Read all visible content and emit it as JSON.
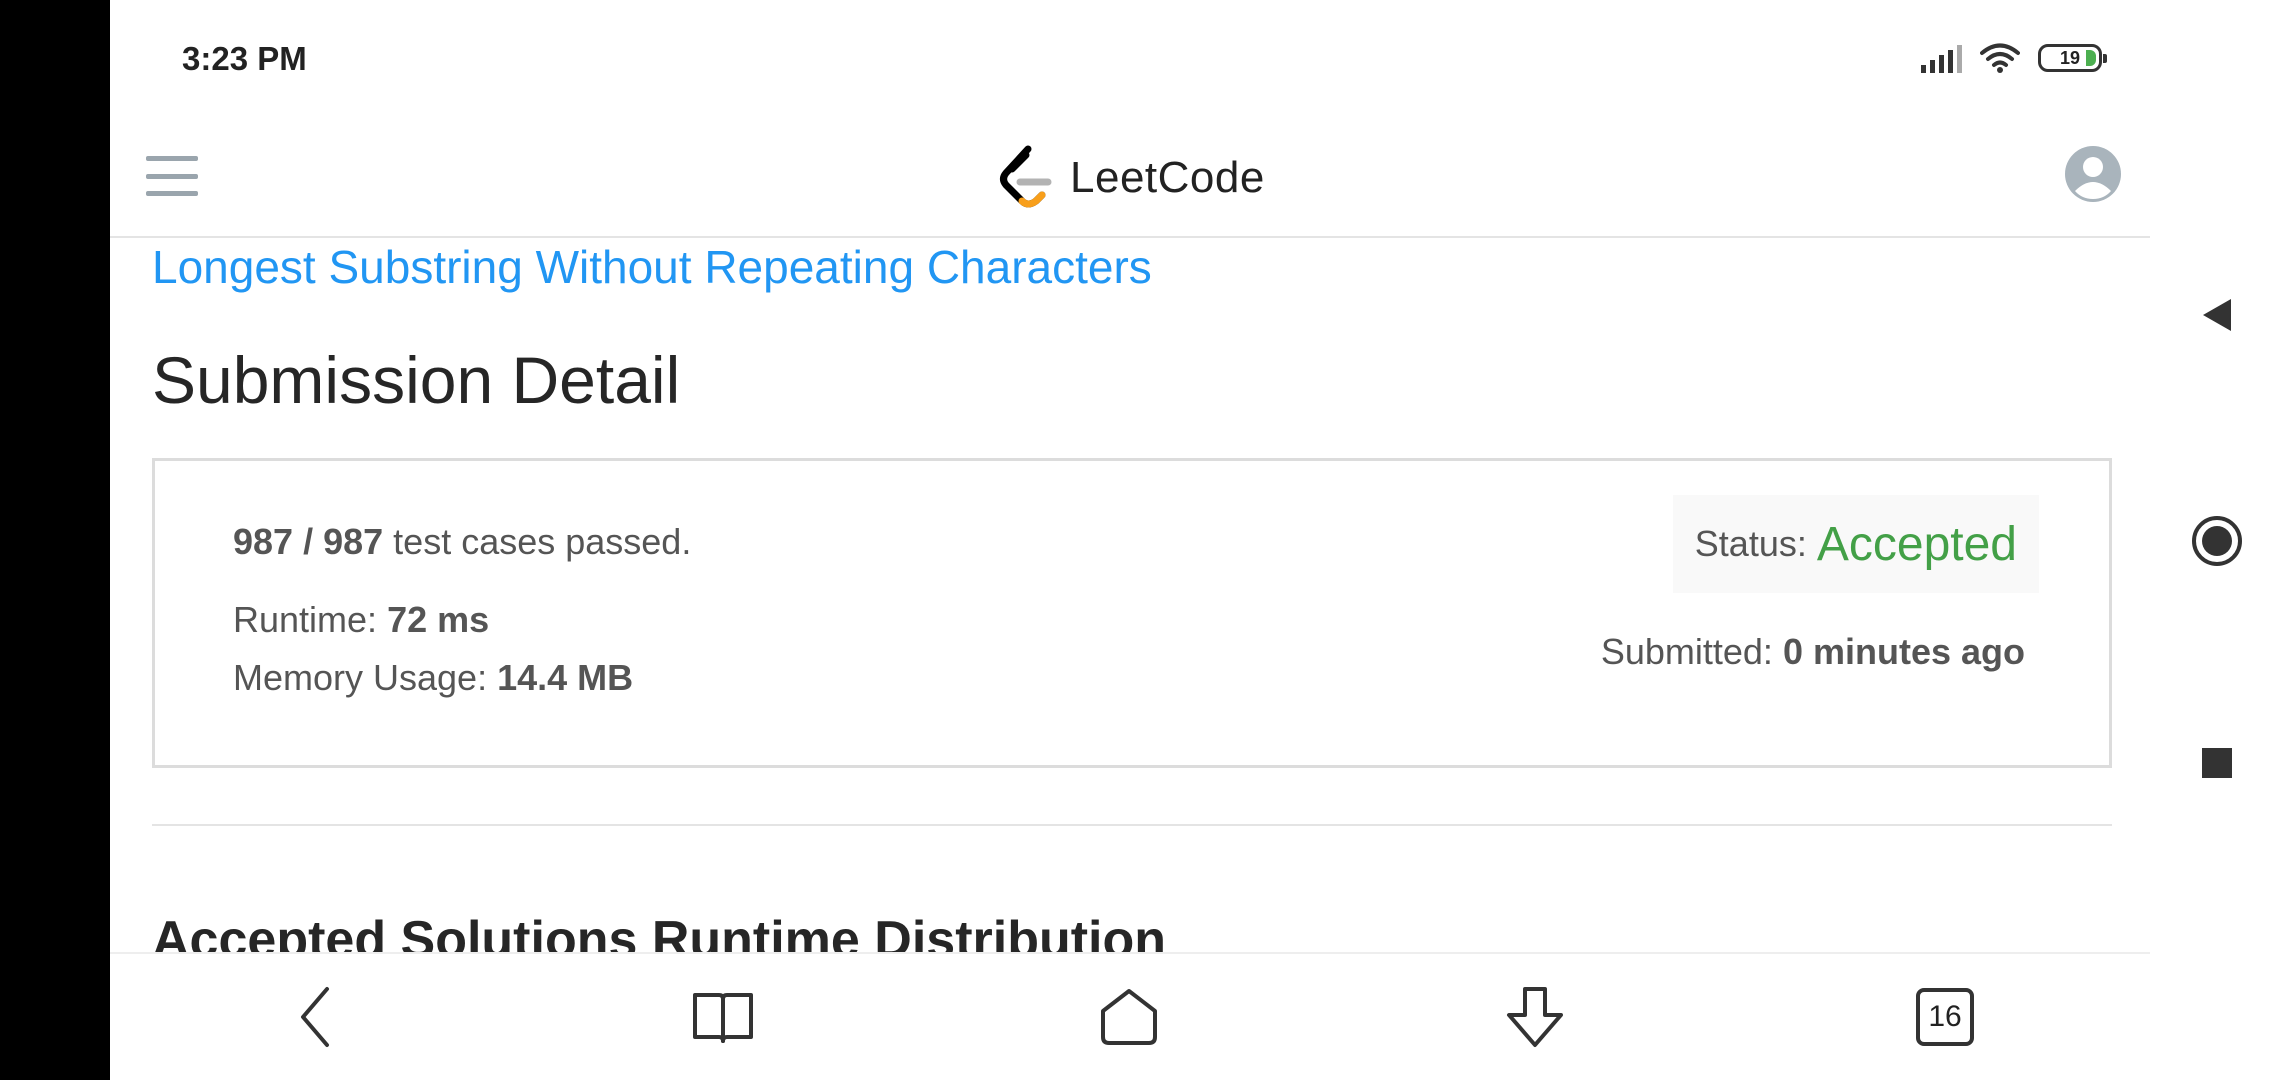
{
  "status_bar": {
    "time": "3:23 PM",
    "battery": "19"
  },
  "header": {
    "logo_text": "LeetCode"
  },
  "problem": {
    "title": "Longest Substring Without Repeating Characters"
  },
  "page": {
    "title": "Submission Detail"
  },
  "submission": {
    "passed": "987",
    "separator": " / ",
    "total": "987",
    "passed_suffix": " test cases passed.",
    "runtime_label": "Runtime: ",
    "runtime_value": "72 ms",
    "memory_label": "Memory Usage: ",
    "memory_value": "14.4 MB",
    "status_label": "Status:",
    "status_value": "Accepted",
    "submitted_label": "Submitted: ",
    "submitted_value": "0 minutes ago"
  },
  "section": {
    "title": "Accepted Solutions Runtime Distribution"
  },
  "toolbar": {
    "tabs_count": "16"
  },
  "colors": {
    "link": "#2196f3",
    "accepted": "#43a047",
    "logo_orange": "#f89f1b"
  },
  "icons": {
    "menu": "hamburger-icon",
    "profile": "user-avatar-icon",
    "back": "chevron-left-icon",
    "bookmarks": "open-book-icon",
    "home": "home-icon",
    "download": "arrow-down-icon",
    "tabs": "tabs-icon",
    "sys_back": "triangle-back-icon",
    "sys_home": "circle-home-icon",
    "sys_recents": "square-recents-icon"
  }
}
